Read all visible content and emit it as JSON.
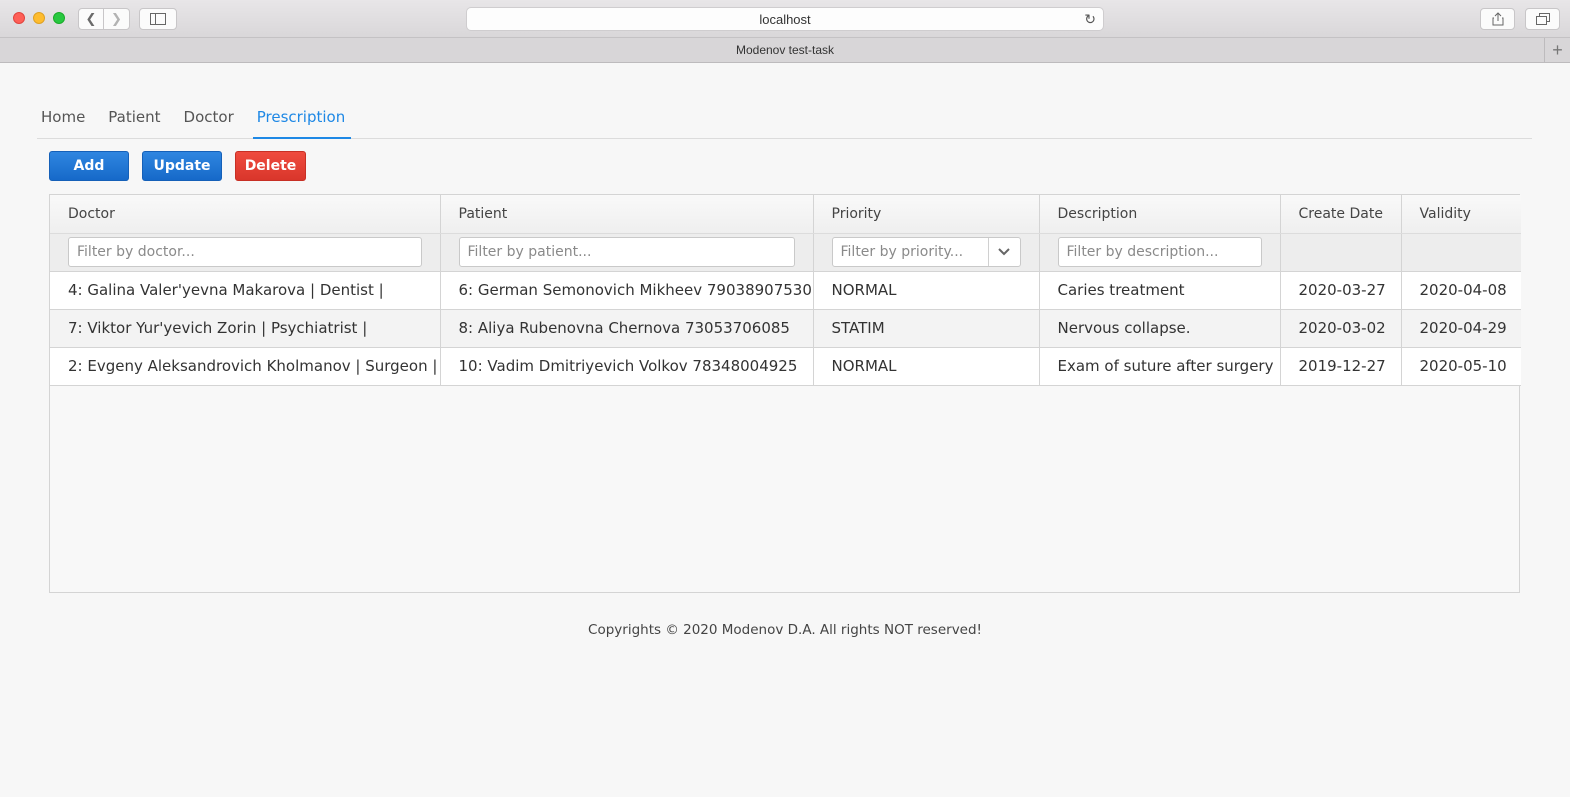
{
  "browser": {
    "url": "localhost",
    "tab_title": "Modenov test-task"
  },
  "nav": {
    "tabs": [
      {
        "label": "Home"
      },
      {
        "label": "Patient"
      },
      {
        "label": "Doctor"
      },
      {
        "label": "Prescription",
        "active": true
      }
    ]
  },
  "toolbar": {
    "add_label": "Add",
    "update_label": "Update",
    "delete_label": "Delete"
  },
  "table": {
    "columns": [
      "Doctor",
      "Patient",
      "Priority",
      "Description",
      "Create Date",
      "Validity"
    ],
    "filters": {
      "doctor": "Filter by doctor...",
      "patient": "Filter by patient...",
      "priority": "Filter by priority...",
      "description": "Filter by description..."
    },
    "rows": [
      [
        "4: Galina Valer'yevna Makarova | Dentist |",
        "6: German Semonovich Mikheev 79038907530",
        "NORMAL",
        "Caries treatment",
        "2020-03-27",
        "2020-04-08"
      ],
      [
        "7: Viktor Yur'yevich Zorin | Psychiatrist |",
        "8: Aliya Rubenovna Chernova 73053706085",
        "STATIM",
        "Nervous collapse.",
        "2020-03-02",
        "2020-04-29"
      ],
      [
        "2: Evgeny Aleksandrovich Kholmanov | Surgeon |",
        "10: Vadim Dmitriyevich Volkov 78348004925",
        "NORMAL",
        "Exam of suture after surgery",
        "2019-12-27",
        "2020-05-10"
      ]
    ]
  },
  "footer": {
    "text": "Copyrights © 2020 Modenov D.A. All rights NOT reserved!"
  },
  "colors": {
    "accent": "#1e88e5",
    "primary_button": "#1669c9",
    "danger_button": "#d9362b"
  }
}
